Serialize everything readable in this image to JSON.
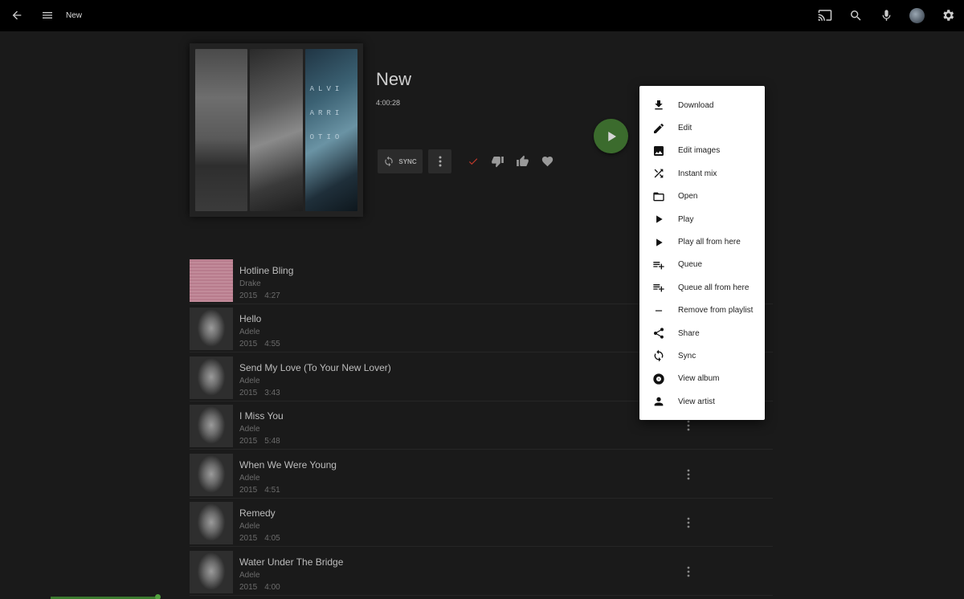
{
  "topbar": {
    "title": "New"
  },
  "album": {
    "title": "New",
    "duration": "4:00:28",
    "sync_label": "SYNC",
    "cover_text": [
      "ALVI",
      "ARRI",
      "OTIO"
    ]
  },
  "tracks": [
    {
      "title": "Hotline Bling",
      "artist": "Drake",
      "year": "2015",
      "length": "4:27"
    },
    {
      "title": "Hello",
      "artist": "Adele",
      "year": "2015",
      "length": "4:55"
    },
    {
      "title": "Send My Love (To Your New Lover)",
      "artist": "Adele",
      "year": "2015",
      "length": "3:43"
    },
    {
      "title": "I Miss You",
      "artist": "Adele",
      "year": "2015",
      "length": "5:48"
    },
    {
      "title": "When We Were Young",
      "artist": "Adele",
      "year": "2015",
      "length": "4:51"
    },
    {
      "title": "Remedy",
      "artist": "Adele",
      "year": "2015",
      "length": "4:05"
    },
    {
      "title": "Water Under The Bridge",
      "artist": "Adele",
      "year": "2015",
      "length": "4:00"
    }
  ],
  "menu": {
    "items": [
      {
        "label": "Download",
        "icon": "download-icon"
      },
      {
        "label": "Edit",
        "icon": "pencil-icon"
      },
      {
        "label": "Edit images",
        "icon": "image-icon"
      },
      {
        "label": "Instant mix",
        "icon": "shuffle-icon"
      },
      {
        "label": "Open",
        "icon": "folder-icon"
      },
      {
        "label": "Play",
        "icon": "play-icon"
      },
      {
        "label": "Play all from here",
        "icon": "play-icon"
      },
      {
        "label": "Queue",
        "icon": "playlist-add-icon"
      },
      {
        "label": "Queue all from here",
        "icon": "playlist-add-icon"
      },
      {
        "label": "Remove from playlist",
        "icon": "minus-icon"
      },
      {
        "label": "Share",
        "icon": "share-icon"
      },
      {
        "label": "Sync",
        "icon": "sync-icon"
      },
      {
        "label": "View album",
        "icon": "album-icon"
      },
      {
        "label": "View artist",
        "icon": "person-icon"
      }
    ]
  },
  "colors": {
    "accent": "#3b6b2d",
    "progress": "#3b7a2f",
    "played_check": "#c0392b"
  }
}
